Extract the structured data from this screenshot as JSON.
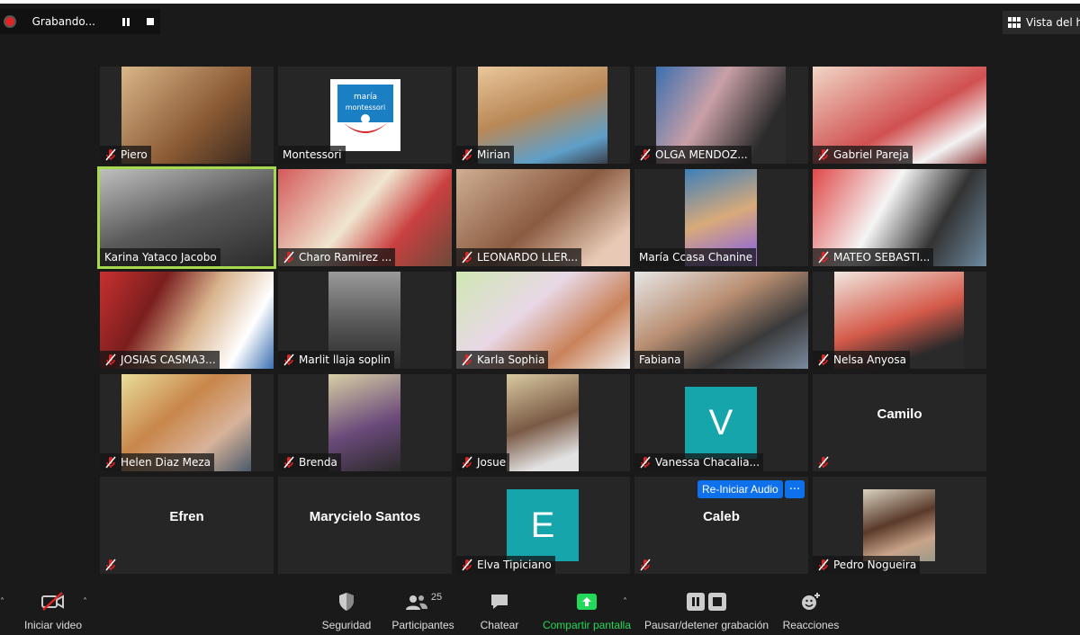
{
  "recording": {
    "status": "Grabando..."
  },
  "view_button": {
    "label": "Vista del ha"
  },
  "participants": [
    {
      "name": "Piero",
      "muted": true
    },
    {
      "name": "Montessori",
      "muted": false,
      "logo": "maría montessori"
    },
    {
      "name": "Mirian",
      "muted": true
    },
    {
      "name": "OLGA MENDOZ...",
      "muted": true
    },
    {
      "name": "Gabriel Pareja",
      "muted": true
    },
    {
      "name": "Karina Yataco Jacobo",
      "muted": false,
      "active_speaker": true
    },
    {
      "name": "Charo Ramirez ...",
      "muted": true
    },
    {
      "name": "LEONARDO LLER...",
      "muted": true
    },
    {
      "name": "María Ccasa Chanine",
      "muted": false
    },
    {
      "name": "MATEO SEBASTI...",
      "muted": true
    },
    {
      "name": "JOSIAS CASMA3...",
      "muted": true
    },
    {
      "name": "Marlit llaja soplin",
      "muted": true
    },
    {
      "name": "Karla Sophia",
      "muted": true
    },
    {
      "name": "Fabiana",
      "muted": false
    },
    {
      "name": "Nelsa Anyosa",
      "muted": true
    },
    {
      "name": "Helen Diaz Meza",
      "muted": true
    },
    {
      "name": "Brenda",
      "muted": true
    },
    {
      "name": "Josue",
      "muted": true
    },
    {
      "name": "Vanessa Chacalia...",
      "muted": true,
      "avatar_letter": "V"
    },
    {
      "name": "",
      "center_name": "Camilo",
      "muted": true
    },
    {
      "name": "",
      "center_name": "Efren",
      "muted": true
    },
    {
      "name": "",
      "center_name": "Marycielo Santos",
      "muted": false
    },
    {
      "name": "Elva Tipiciano",
      "muted": true,
      "avatar_letter": "E"
    },
    {
      "name": "",
      "center_name": "Caleb",
      "muted": true
    },
    {
      "name": "Pedro Nogueira",
      "muted": true
    }
  ],
  "reiniciar_audio": {
    "label": "Re-Iniciar Audio",
    "more": "···"
  },
  "toolbar": {
    "start_video": "Iniciar video",
    "security": "Seguridad",
    "participants": "Participantes",
    "participants_count": "25",
    "chat": "Chatear",
    "share": "Compartir pantalla",
    "pause_record": "Pausar/detener grabación",
    "reactions": "Reacciones"
  },
  "colors": {
    "accent_green": "#23d959",
    "active_outline": "#a7d94d",
    "blue": "#0e71eb",
    "teal_avatar": "#16a5ab",
    "mute_red": "#e02424"
  }
}
